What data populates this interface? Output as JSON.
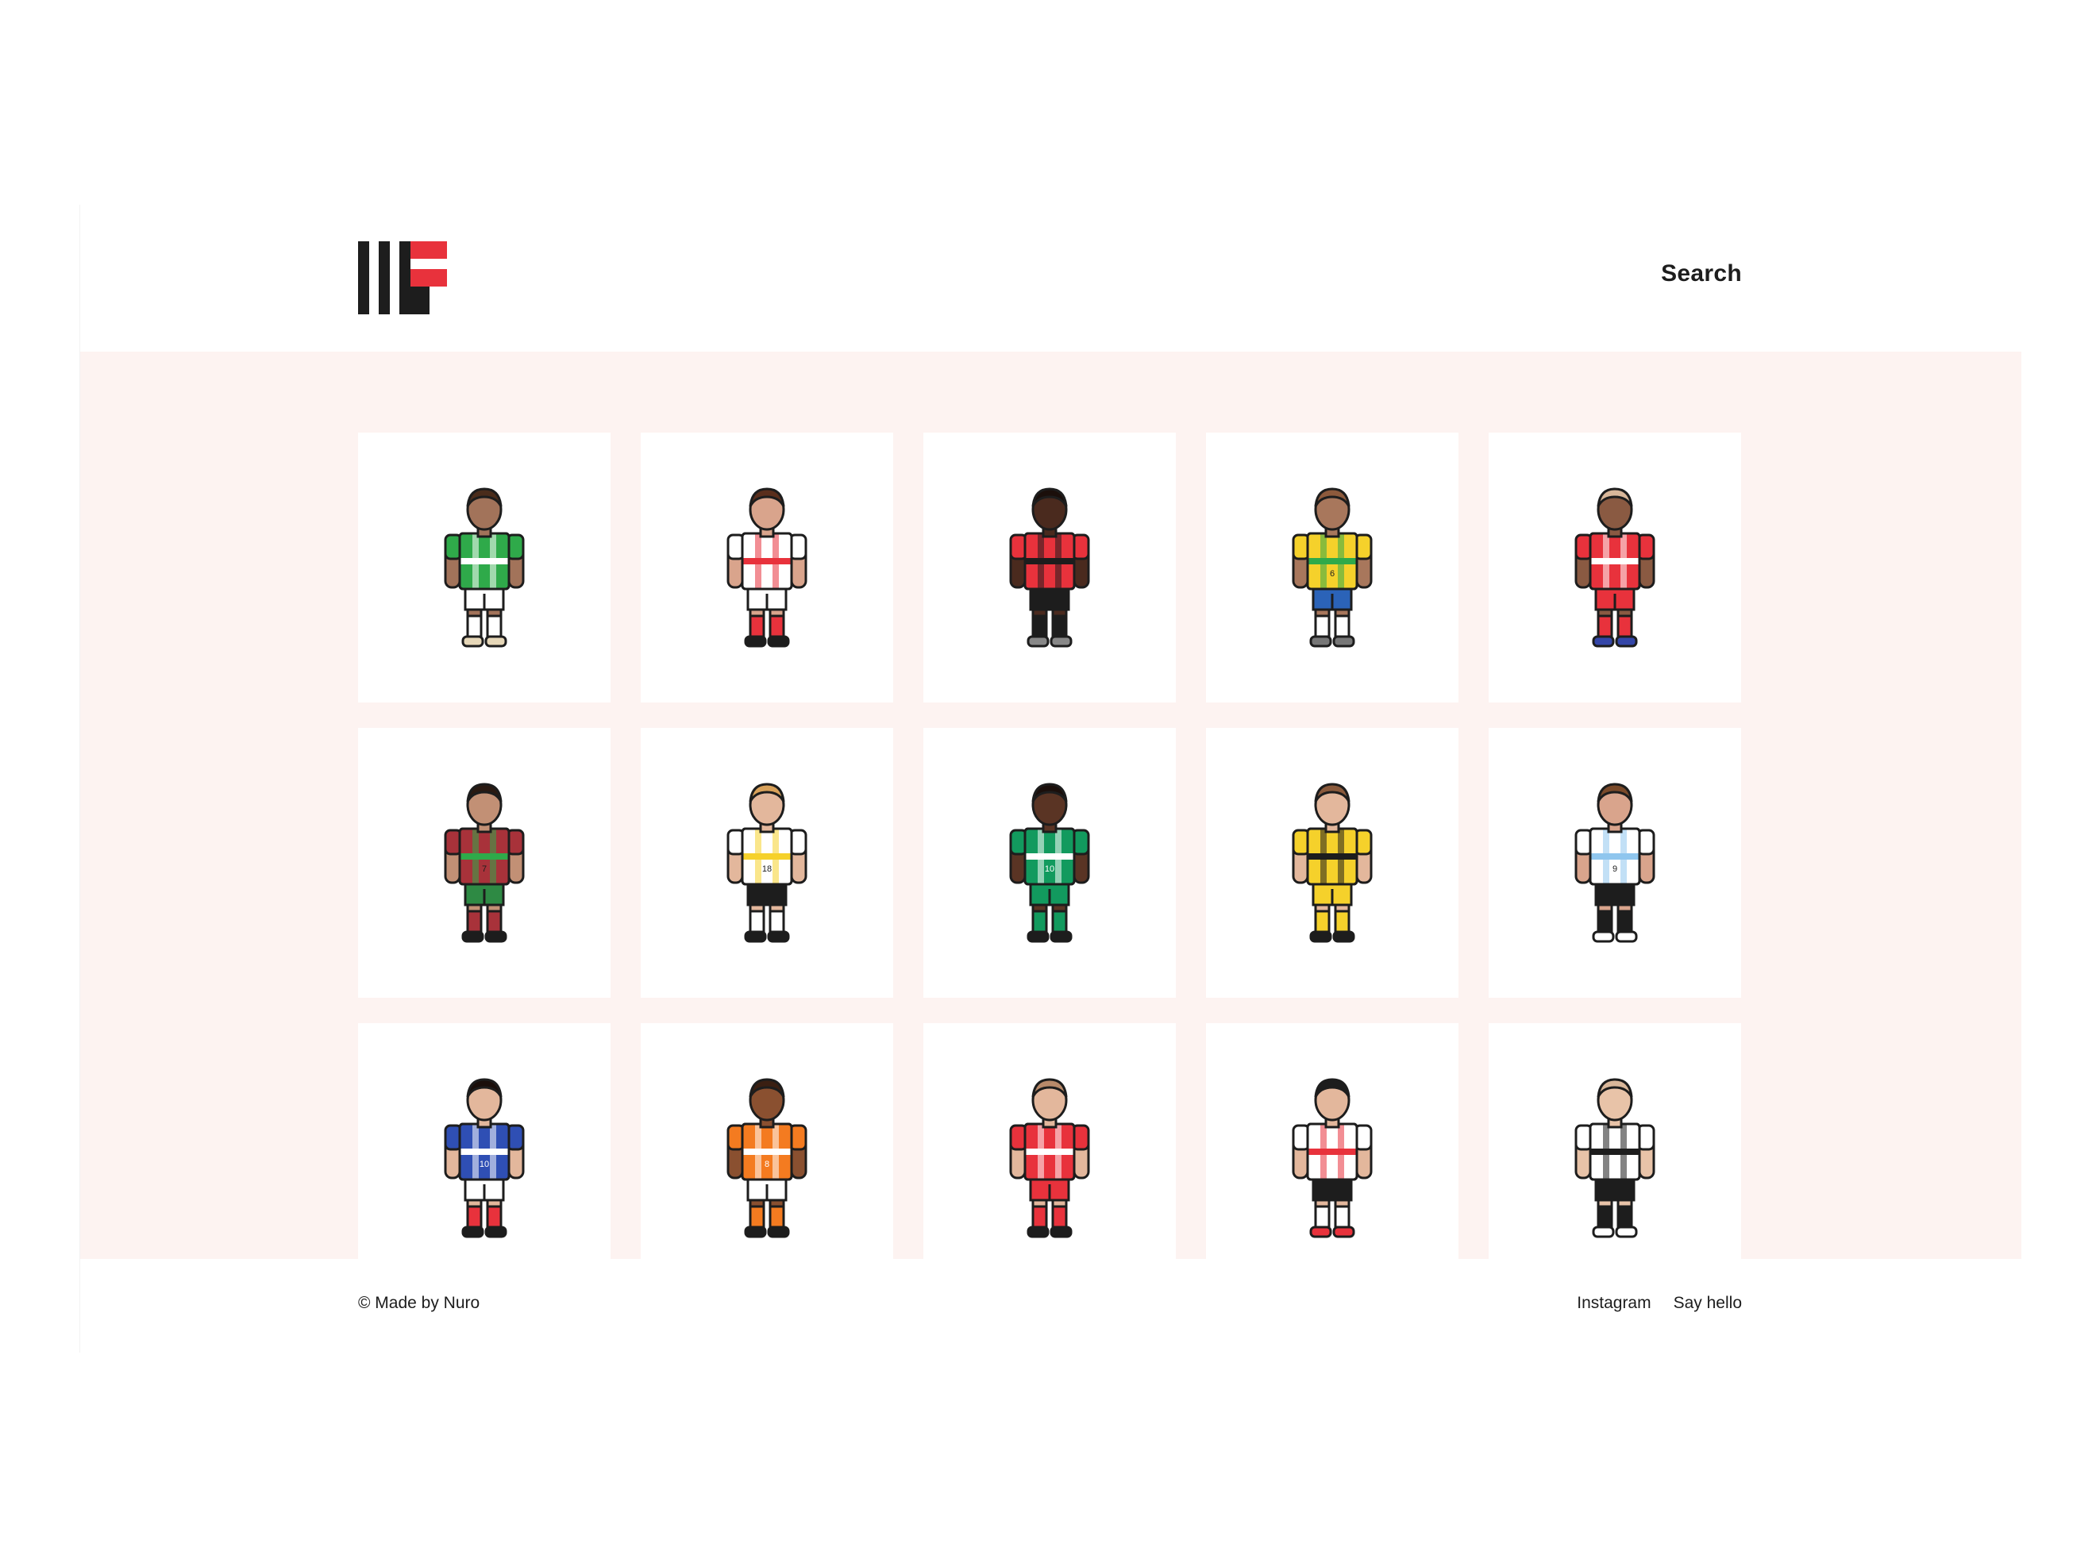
{
  "header": {
    "logo_alt": "IFF",
    "search_label": "Search"
  },
  "colors": {
    "accent": "#e8323c",
    "ink": "#1d1d1d",
    "gallery_bg": "#fdf3f1"
  },
  "players": [
    {
      "name": "green-white-hoops-player",
      "hair": "#4a2c1b",
      "skin": "#a2735a",
      "shirt": "#2faa4a",
      "stripe": "#ffffff",
      "shorts": "#ffffff",
      "socks": "#ffffff",
      "boots": "#e6d7b8",
      "number": ""
    },
    {
      "name": "red-white-player",
      "hair": "#5a2e1c",
      "skin": "#d9a48c",
      "shirt": "#ffffff",
      "stripe": "#e8323c",
      "shorts": "#ffffff",
      "socks": "#e8323c",
      "boots": "#1d1d1d",
      "number": ""
    },
    {
      "name": "red-black-stripes-player",
      "hair": "#1b0f0b",
      "skin": "#4a2a1e",
      "shirt": "#e8323c",
      "stripe": "#1d1d1d",
      "shorts": "#1d1d1d",
      "socks": "#1d1d1d",
      "boots": "#888888",
      "number": ""
    },
    {
      "name": "yellow-green-player",
      "hair": "#8d5a3c",
      "skin": "#a8775c",
      "shirt": "#f5d12b",
      "stripe": "#2faa4a",
      "shorts": "#2b63b8",
      "socks": "#ffffff",
      "boots": "#777777",
      "number": "6"
    },
    {
      "name": "red-kit-bald-player",
      "hair": "#d9b79a",
      "skin": "#8a5a42",
      "shirt": "#e8323c",
      "stripe": "#ffffff",
      "shorts": "#e8323c",
      "socks": "#e8323c",
      "boots": "#3446a8",
      "number": ""
    },
    {
      "name": "maroon-kit-player",
      "hair": "#2a1a12",
      "skin": "#c29075",
      "shirt": "#a8323a",
      "stripe": "#2faa4a",
      "shorts": "#2e8a44",
      "socks": "#a8323a",
      "boots": "#1d1d1d",
      "number": "7"
    },
    {
      "name": "white-black-chevron-player",
      "hair": "#d8a15a",
      "skin": "#e3b79c",
      "shirt": "#ffffff",
      "stripe": "#f5d12b",
      "shorts": "#1d1d1d",
      "socks": "#ffffff",
      "boots": "#1d1d1d",
      "number": "18"
    },
    {
      "name": "green-kit-player",
      "hair": "#1b0f0b",
      "skin": "#5a3424",
      "shirt": "#129a5e",
      "stripe": "#ffffff",
      "shorts": "#129a5e",
      "socks": "#129a5e",
      "boots": "#1d1d1d",
      "number": "10"
    },
    {
      "name": "yellow-kit-player",
      "hair": "#8a5a3c",
      "skin": "#e3b79c",
      "shirt": "#f5d12b",
      "stripe": "#1d1d1d",
      "shorts": "#f5d12b",
      "socks": "#f5d12b",
      "boots": "#1d1d1d",
      "number": ""
    },
    {
      "name": "sky-blue-stripes-player",
      "hair": "#7a4a2a",
      "skin": "#d9a48c",
      "shirt": "#ffffff",
      "stripe": "#8fc6ee",
      "shorts": "#1d1d1d",
      "socks": "#1d1d1d",
      "boots": "#ffffff",
      "number": "9"
    },
    {
      "name": "blue-kit-player",
      "hair": "#1b0f0b",
      "skin": "#e3b79c",
      "shirt": "#2f4fb4",
      "stripe": "#ffffff",
      "shorts": "#ffffff",
      "socks": "#e8323c",
      "boots": "#1d1d1d",
      "number": "10"
    },
    {
      "name": "orange-kit-player",
      "hair": "#3a1f12",
      "skin": "#8a5030",
      "shirt": "#f47b20",
      "stripe": "#ffffff",
      "shorts": "#ffffff",
      "socks": "#f47b20",
      "boots": "#1d1d1d",
      "number": "8"
    },
    {
      "name": "red-kit-player",
      "hair": "#b88a6a",
      "skin": "#e3b79c",
      "shirt": "#e8323c",
      "stripe": "#ffffff",
      "shorts": "#e8323c",
      "socks": "#e8323c",
      "boots": "#1d1d1d",
      "number": ""
    },
    {
      "name": "red-white-stripes-player",
      "hair": "#1d1d1d",
      "skin": "#e3b79c",
      "shirt": "#ffffff",
      "stripe": "#e8323c",
      "shorts": "#1d1d1d",
      "socks": "#ffffff",
      "boots": "#e8323c",
      "number": ""
    },
    {
      "name": "black-white-stripes-player",
      "hair": "#d9b79a",
      "skin": "#e8c3a8",
      "shirt": "#ffffff",
      "stripe": "#1d1d1d",
      "shorts": "#1d1d1d",
      "socks": "#1d1d1d",
      "boots": "#ffffff",
      "number": ""
    }
  ],
  "footer": {
    "copyright": "© Made by Nuro",
    "instagram": "Instagram",
    "say_hello": "Say hello"
  }
}
